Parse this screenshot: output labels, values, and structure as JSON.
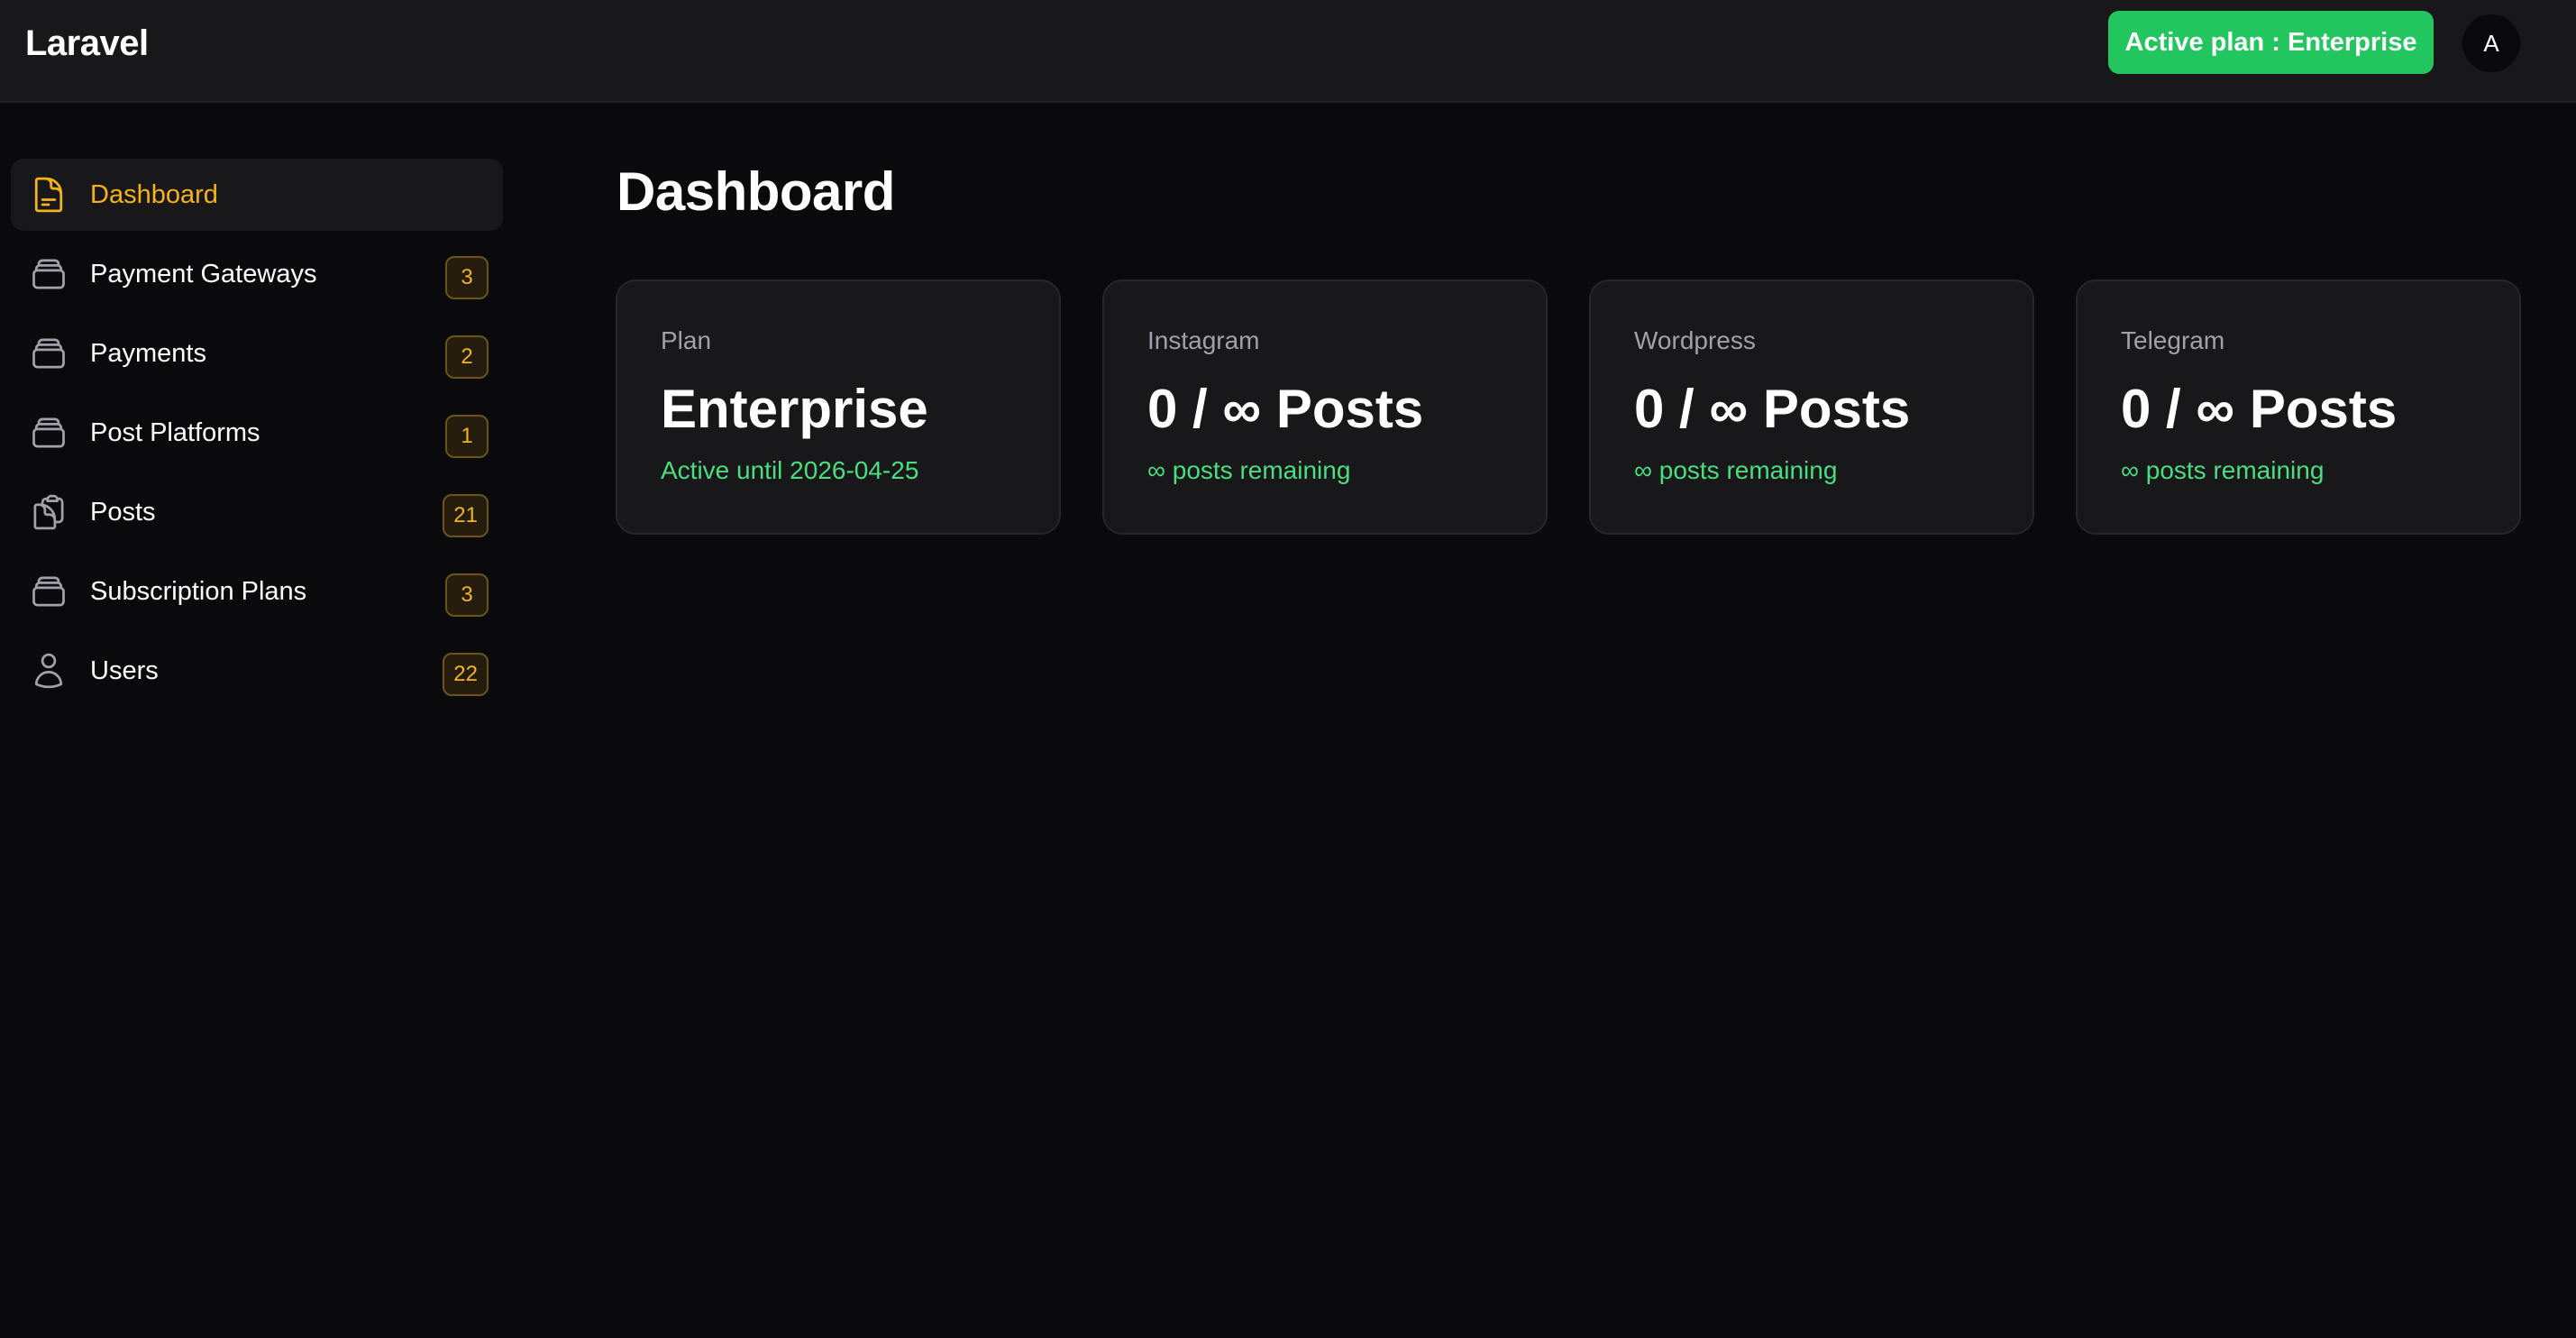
{
  "app": {
    "brand": "Laravel"
  },
  "header": {
    "plan_badge": "Active plan : Enterprise",
    "avatar_initial": "A"
  },
  "sidebar": {
    "items": [
      {
        "label": "Dashboard",
        "icon": "document-icon",
        "badge": null,
        "active": true
      },
      {
        "label": "Payment Gateways",
        "icon": "archive-box-icon",
        "badge": "3",
        "active": false
      },
      {
        "label": "Payments",
        "icon": "archive-box-icon",
        "badge": "2",
        "active": false
      },
      {
        "label": "Post Platforms",
        "icon": "archive-box-icon",
        "badge": "1",
        "active": false
      },
      {
        "label": "Posts",
        "icon": "clipboard-icon",
        "badge": "21",
        "active": false
      },
      {
        "label": "Subscription Plans",
        "icon": "archive-box-icon",
        "badge": "3",
        "active": false
      },
      {
        "label": "Users",
        "icon": "user-icon",
        "badge": "22",
        "active": false
      }
    ]
  },
  "main": {
    "title": "Dashboard",
    "cards": [
      {
        "label": "Plan",
        "value": "Enterprise",
        "sub": "Active until 2026-04-25"
      },
      {
        "label": "Instagram",
        "value": "0 / ∞ Posts",
        "sub": "∞ posts remaining"
      },
      {
        "label": "Wordpress",
        "value": "0 / ∞ Posts",
        "sub": "∞ posts remaining"
      },
      {
        "label": "Telegram",
        "value": "0 / ∞ Posts",
        "sub": "∞ posts remaining"
      }
    ]
  },
  "colors": {
    "accent": "#f5b31a",
    "success": "#22c55e",
    "success_text": "#4ade80",
    "background": "#0a0a0c",
    "surface": "#18181b"
  }
}
